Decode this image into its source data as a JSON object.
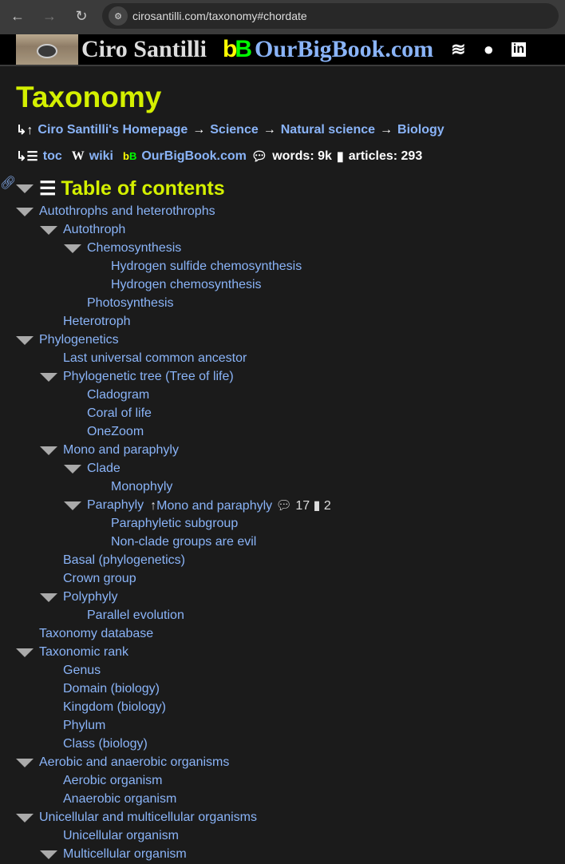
{
  "browser": {
    "url": "cirosantilli.com/taxonomy#chordate"
  },
  "banner": {
    "name": "Ciro Santilli",
    "site": "OurBigBook.com",
    "logo": "bB"
  },
  "page": {
    "title": "Taxonomy",
    "breadcrumb": [
      "Ciro Santilli's Homepage",
      "Science",
      "Natural science",
      "Biology"
    ],
    "meta": {
      "toc": "toc",
      "wiki": "wiki",
      "obb": "OurBigBook.com",
      "words": "words: 9k",
      "articles": "articles: 293"
    }
  },
  "toc": {
    "title": "Table of contents",
    "items": [
      {
        "l": 0,
        "t": 1,
        "label": "Autothrophs and heterothrophs"
      },
      {
        "l": 1,
        "t": 1,
        "label": "Autothroph"
      },
      {
        "l": 2,
        "t": 1,
        "label": "Chemosynthesis"
      },
      {
        "l": 3,
        "t": 0,
        "label": "Hydrogen sulfide chemosynthesis"
      },
      {
        "l": 3,
        "t": 0,
        "label": "Hydrogen chemosynthesis"
      },
      {
        "l": 2,
        "t": 0,
        "label": "Photosynthesis"
      },
      {
        "l": 1,
        "t": 0,
        "label": "Heterotroph"
      },
      {
        "l": 0,
        "t": 1,
        "label": "Phylogenetics"
      },
      {
        "l": 1,
        "t": 0,
        "label": "Last universal common ancestor"
      },
      {
        "l": 1,
        "t": 1,
        "label": "Phylogenetic tree (Tree of life)"
      },
      {
        "l": 2,
        "t": 0,
        "label": "Cladogram"
      },
      {
        "l": 2,
        "t": 0,
        "label": "Coral of life"
      },
      {
        "l": 2,
        "t": 0,
        "label": "OneZoom"
      },
      {
        "l": 1,
        "t": 1,
        "label": "Mono and paraphyly"
      },
      {
        "l": 2,
        "t": 1,
        "label": "Clade"
      },
      {
        "l": 3,
        "t": 0,
        "label": "Monophyly"
      },
      {
        "l": 2,
        "t": 1,
        "label": "Paraphyly",
        "parent": "Mono and paraphyly",
        "comments": "17",
        "articles": "2"
      },
      {
        "l": 3,
        "t": 0,
        "label": "Paraphyletic subgroup"
      },
      {
        "l": 3,
        "t": 0,
        "label": "Non-clade groups are evil"
      },
      {
        "l": 1,
        "t": 0,
        "label": "Basal (phylogenetics)"
      },
      {
        "l": 1,
        "t": 0,
        "label": "Crown group"
      },
      {
        "l": 1,
        "t": 1,
        "label": "Polyphyly"
      },
      {
        "l": 2,
        "t": 0,
        "label": "Parallel evolution"
      },
      {
        "l": 0,
        "t": 0,
        "label": "Taxonomy database"
      },
      {
        "l": 0,
        "t": 1,
        "label": "Taxonomic rank"
      },
      {
        "l": 1,
        "t": 0,
        "label": "Genus"
      },
      {
        "l": 1,
        "t": 0,
        "label": "Domain (biology)"
      },
      {
        "l": 1,
        "t": 0,
        "label": "Kingdom (biology)"
      },
      {
        "l": 1,
        "t": 0,
        "label": "Phylum"
      },
      {
        "l": 1,
        "t": 0,
        "label": "Class (biology)"
      },
      {
        "l": 0,
        "t": 1,
        "label": "Aerobic and anaerobic organisms"
      },
      {
        "l": 1,
        "t": 0,
        "label": "Aerobic organism"
      },
      {
        "l": 1,
        "t": 0,
        "label": "Anaerobic organism"
      },
      {
        "l": 0,
        "t": 1,
        "label": "Unicellular and multicellular organisms"
      },
      {
        "l": 1,
        "t": 0,
        "label": "Unicellular organism"
      },
      {
        "l": 1,
        "t": 1,
        "label": "Multicellular organism"
      }
    ]
  }
}
